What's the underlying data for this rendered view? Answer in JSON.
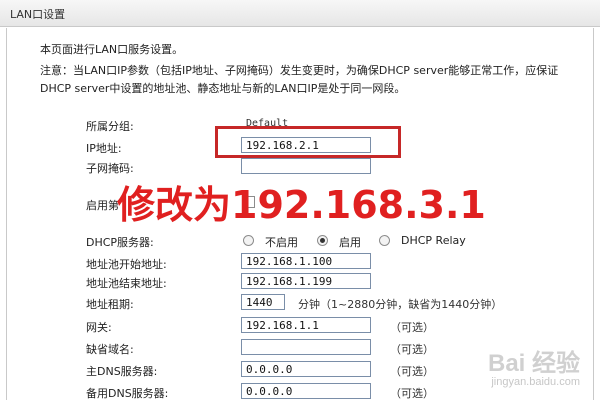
{
  "window": {
    "title": "LAN口设置"
  },
  "intro": "本页面进行LAN口服务设置。",
  "note": "注意：当LAN口IP参数（包括IP地址、子网掩码）发生变更时，为确保DHCP server能够正常工作，应保证DHCP server中设置的地址池、静态地址与新的LAN口IP是处于同一网段。",
  "form": {
    "group_label": "所属分组:",
    "group_value": "Default",
    "ip_label": "IP地址:",
    "ip_value": "192.168.2.1",
    "mask_label": "子网掩码:",
    "enable_label": "启用第",
    "dhcp_label": "DHCP服务器:",
    "dhcp_options": [
      "不启用",
      "启用",
      "DHCP Relay"
    ],
    "dhcp_selected": "启用",
    "pool_start_label": "地址池开始地址:",
    "pool_start_value": "192.168.1.100",
    "pool_end_label": "地址池结束地址:",
    "pool_end_value": "192.168.1.199",
    "lease_label": "地址租期:",
    "lease_value": "1440",
    "lease_unit": "分钟（1~2880分钟，缺省为1440分钟）",
    "gateway_label": "网关:",
    "gateway_value": "192.168.1.1",
    "domain_label": "缺省域名:",
    "domain_value": "",
    "dns1_label": "主DNS服务器:",
    "dns1_value": "0.0.0.0",
    "dns2_label": "备用DNS服务器:",
    "dns2_value": "0.0.0.0",
    "optional": "（可选）"
  },
  "annotation": {
    "text": "修改为192.168.3.1",
    "color": "#e02020",
    "box_color": "#c62828"
  },
  "watermark": {
    "text": "Bai 经验",
    "sub": "jingyan.baidu.com"
  }
}
